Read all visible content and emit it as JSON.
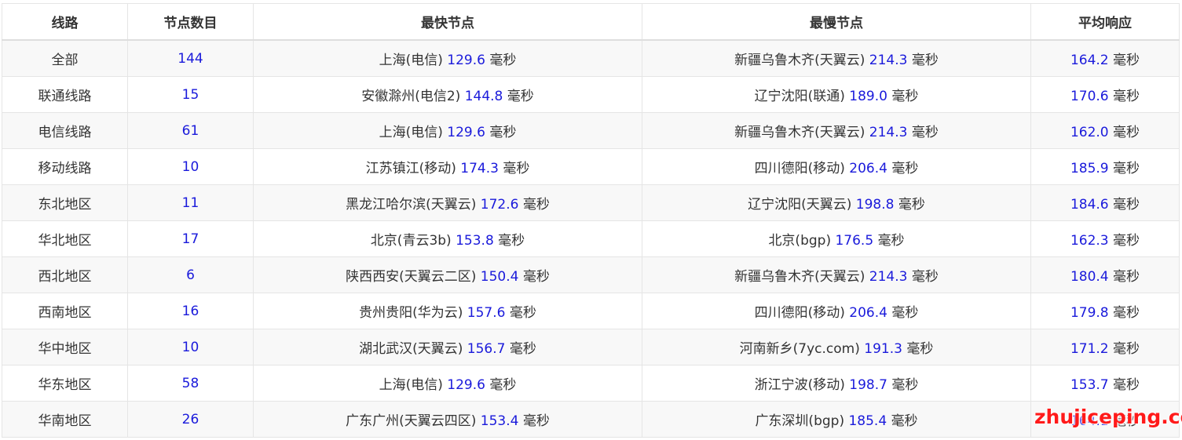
{
  "headers": [
    "线路",
    "节点数目",
    "最快节点",
    "最慢节点",
    "平均响应"
  ],
  "unit": "毫秒",
  "rows": [
    {
      "line": "全部",
      "count": "144",
      "fast_name": "上海(电信)",
      "fast_ms": "129.6",
      "slow_name": "新疆乌鲁木齐(天翼云)",
      "slow_ms": "214.3",
      "avg_ms": "164.2"
    },
    {
      "line": "联通线路",
      "count": "15",
      "fast_name": "安徽滁州(电信2)",
      "fast_ms": "144.8",
      "slow_name": "辽宁沈阳(联通)",
      "slow_ms": "189.0",
      "avg_ms": "170.6"
    },
    {
      "line": "电信线路",
      "count": "61",
      "fast_name": "上海(电信)",
      "fast_ms": "129.6",
      "slow_name": "新疆乌鲁木齐(天翼云)",
      "slow_ms": "214.3",
      "avg_ms": "162.0"
    },
    {
      "line": "移动线路",
      "count": "10",
      "fast_name": "江苏镇江(移动)",
      "fast_ms": "174.3",
      "slow_name": "四川德阳(移动)",
      "slow_ms": "206.4",
      "avg_ms": "185.9"
    },
    {
      "line": "东北地区",
      "count": "11",
      "fast_name": "黑龙江哈尔滨(天翼云)",
      "fast_ms": "172.6",
      "slow_name": "辽宁沈阳(天翼云)",
      "slow_ms": "198.8",
      "avg_ms": "184.6"
    },
    {
      "line": "华北地区",
      "count": "17",
      "fast_name": "北京(青云3b)",
      "fast_ms": "153.8",
      "slow_name": "北京(bgp)",
      "slow_ms": "176.5",
      "avg_ms": "162.3"
    },
    {
      "line": "西北地区",
      "count": "6",
      "fast_name": "陕西西安(天翼云二区)",
      "fast_ms": "150.4",
      "slow_name": "新疆乌鲁木齐(天翼云)",
      "slow_ms": "214.3",
      "avg_ms": "180.4"
    },
    {
      "line": "西南地区",
      "count": "16",
      "fast_name": "贵州贵阳(华为云)",
      "fast_ms": "157.6",
      "slow_name": "四川德阳(移动)",
      "slow_ms": "206.4",
      "avg_ms": "179.8"
    },
    {
      "line": "华中地区",
      "count": "10",
      "fast_name": "湖北武汉(天翼云)",
      "fast_ms": "156.7",
      "slow_name": "河南新乡(7yc.com)",
      "slow_ms": "191.3",
      "avg_ms": "171.2"
    },
    {
      "line": "华东地区",
      "count": "58",
      "fast_name": "上海(电信)",
      "fast_ms": "129.6",
      "slow_name": "浙江宁波(移动)",
      "slow_ms": "198.7",
      "avg_ms": "153.7"
    },
    {
      "line": "华南地区",
      "count": "26",
      "fast_name": "广东广州(天翼云四区)",
      "fast_ms": "153.4",
      "slow_name": "广东深圳(bgp)",
      "slow_ms": "185.4",
      "avg_ms": "164.1"
    }
  ],
  "watermark": "zhujiceping.com",
  "colors": {
    "value_blue": "#1a1adb",
    "text": "#333333",
    "stripe": "#f8f8f8",
    "border": "#e5e5e5",
    "watermark_red": "#ff1a1a"
  }
}
